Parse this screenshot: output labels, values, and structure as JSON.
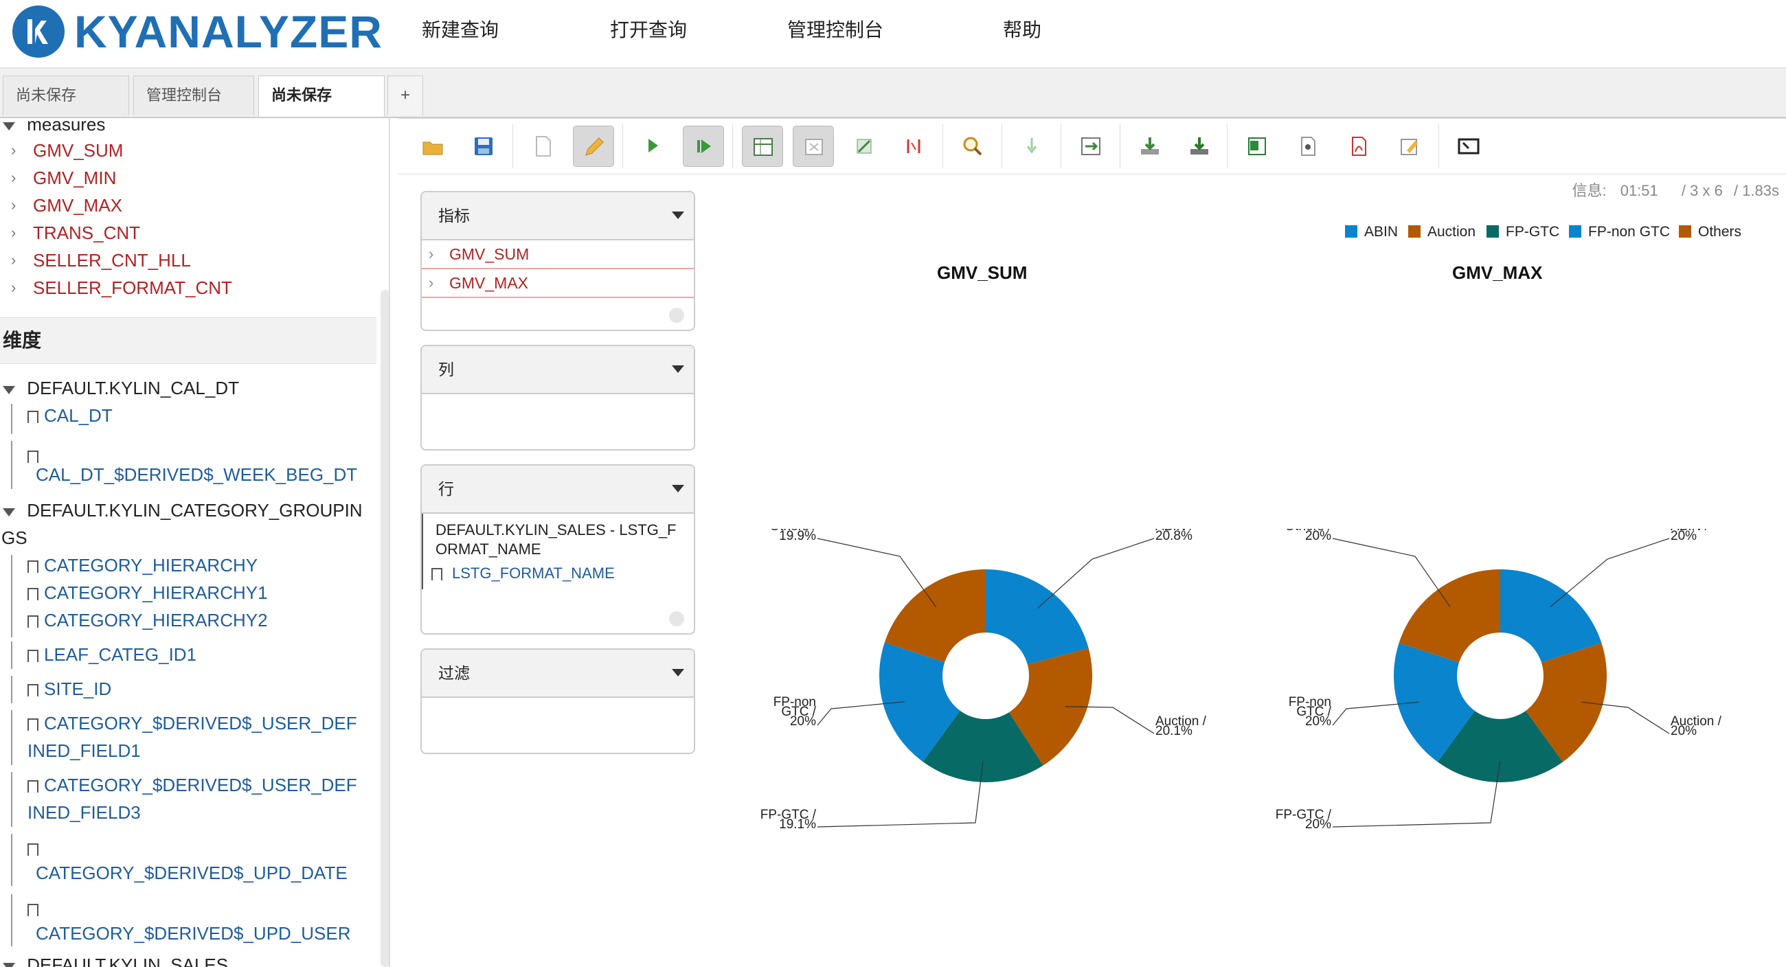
{
  "app": {
    "logo": "KYANALYZER"
  },
  "topnav": [
    "新建查询",
    "打开查询",
    "管理控制台",
    "帮助"
  ],
  "tabs": [
    {
      "label": "尚未保存 (1)",
      "active": false
    },
    {
      "label": "管理控制台",
      "active": false
    },
    {
      "label": "尚未保存 (3)",
      "active": true
    }
  ],
  "tab_add": "+",
  "sidebar": {
    "measures_header": "measures",
    "measures": [
      "GMV_SUM",
      "GMV_MIN",
      "GMV_MAX",
      "TRANS_CNT",
      "SELLER_CNT_HLL",
      "SELLER_FORMAT_CNT"
    ],
    "dimensions_title": "维度",
    "cal_dt_group": "DEFAULT.KYLIN_CAL_DT",
    "cal_dt_items": [
      "CAL_DT",
      "CAL_DT_$DERIVED$_WEEK_BEG_DT"
    ],
    "category_group_line1": "DEFAULT.KYLIN_CATEGORY_GROUPIN",
    "category_group_line2": "GS",
    "category_items": [
      "CATEGORY_HIERARCHY",
      "CATEGORY_HIERARCHY1",
      "CATEGORY_HIERARCHY2",
      "LEAF_CATEG_ID1",
      "SITE_ID"
    ],
    "user_def1_line1": "CATEGORY_$DERIVED$_USER_DEF",
    "user_def1_line2": "INED_FIELD1",
    "user_def3_line1": "CATEGORY_$DERIVED$_USER_DEF",
    "user_def3_line2": "INED_FIELD3",
    "upd_date": "CATEGORY_$DERIVED$_UPD_DATE",
    "upd_user": "CATEGORY_$DERIVED$_UPD_USER",
    "sales_group": "DEFAULT.KYLIN_SALES"
  },
  "toolbar_icons": [
    "open-folder-icon",
    "save-icon",
    "new-file-icon",
    "edit-pencil-icon",
    "run-icon",
    "auto-run-icon",
    "table-view-icon",
    "hide-empty-icon",
    "swap-axes-icon",
    "non-empty-icon",
    "zoom-icon",
    "drill-down-icon",
    "export-icon",
    "download-icon",
    "download-all-icon",
    "excel-icon",
    "csv-icon",
    "pdf-icon",
    "edit-doc-icon",
    "fullscreen-icon"
  ],
  "info": {
    "label": "信息:",
    "time": "01:51",
    "dims": "/ 3 x 6",
    "duration": "/ 1.83s"
  },
  "panels": {
    "measures": {
      "title": "指标",
      "items": [
        "GMV_SUM",
        "GMV_MAX"
      ]
    },
    "columns": {
      "title": "列"
    },
    "rows": {
      "title": "行",
      "group_line1": "DEFAULT.KYLIN_SALES - LSTG_F",
      "group_line2": "ORMAT_NAME",
      "item": "LSTG_FORMAT_NAME"
    },
    "filter": {
      "title": "过滤"
    }
  },
  "legend": [
    {
      "name": "ABIN",
      "color": "#0a84cc"
    },
    {
      "name": "Auction",
      "color": "#b35900"
    },
    {
      "name": "FP-GTC",
      "color": "#086a64"
    },
    {
      "name": "FP-non GTC",
      "color": "#0a84cc"
    },
    {
      "name": "Others",
      "color": "#b35900"
    }
  ],
  "chart_data": [
    {
      "type": "pie",
      "title": "GMV_SUM",
      "categories": [
        "ABIN",
        "Auction",
        "FP-GTC",
        "FP-non GTC",
        "Others"
      ],
      "values": [
        20.8,
        20.1,
        19.1,
        20,
        19.9
      ],
      "labels": [
        [
          "ABIN /",
          "20.8%"
        ],
        [
          "Auction /",
          "20.1%"
        ],
        [
          "FP-GTC /",
          "19.1%"
        ],
        [
          "FP-non",
          "GTC /",
          "20%"
        ],
        [
          "Others /",
          "19.9%"
        ]
      ],
      "colors": [
        "#0a84cc",
        "#b35900",
        "#086a64",
        "#0a84cc",
        "#b35900"
      ]
    },
    {
      "type": "pie",
      "title": "GMV_MAX",
      "categories": [
        "ABIN",
        "Auction",
        "FP-GTC",
        "FP-non GTC",
        "Others"
      ],
      "values": [
        20,
        20,
        20,
        20,
        20
      ],
      "labels": [
        [
          "ABIN /",
          "20%"
        ],
        [
          "Auction /",
          "20%"
        ],
        [
          "FP-GTC /",
          "20%"
        ],
        [
          "FP-non",
          "GTC /",
          "20%"
        ],
        [
          "Others /",
          "20%"
        ]
      ],
      "colors": [
        "#0a84cc",
        "#b35900",
        "#086a64",
        "#0a84cc",
        "#b35900"
      ]
    }
  ]
}
